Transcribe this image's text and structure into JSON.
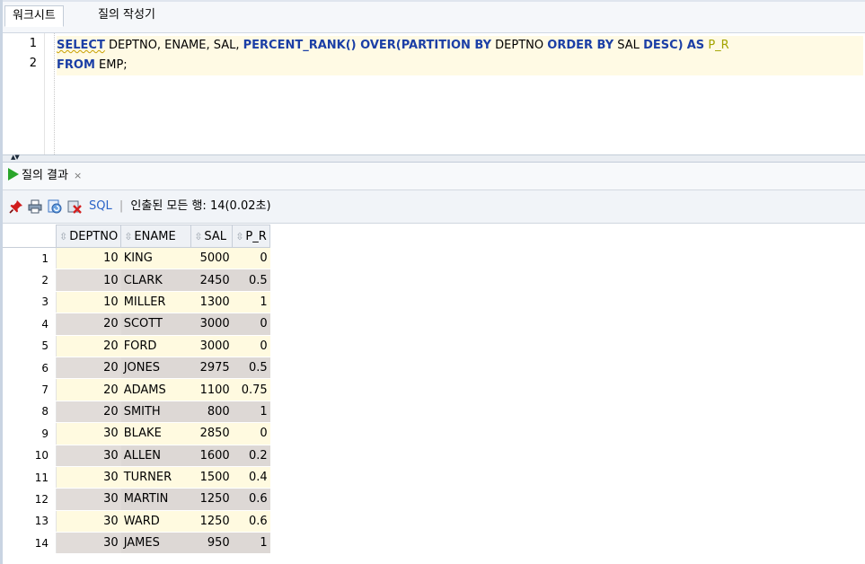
{
  "tabs": [
    "워크시트",
    "질의 작성기"
  ],
  "editor": {
    "line_numbers": [
      "1",
      "2"
    ],
    "line1": {
      "kw_select": "SELECT",
      "t1": " DEPTNO, ENAME, SAL, ",
      "kw_func": "PERCENT_RANK() OVER(PARTITION BY",
      "t2": " DEPTNO ",
      "kw_order": "ORDER BY",
      "t3": " SAL ",
      "kw_desc": "DESC)",
      "t4": " ",
      "kw_as": "AS",
      "t5": " ",
      "alias": "P_R"
    },
    "line2": {
      "kw_from": "FROM",
      "t1": " EMP;"
    }
  },
  "results": {
    "tab_label": "질의 결과",
    "close_glyph": "×",
    "toolbar": {
      "sql_label": "SQL",
      "separator": "|",
      "status": "인출된 모든 행: 14(0.02초)"
    },
    "sort_glyph": "⇳",
    "columns": [
      "DEPTNO",
      "ENAME",
      "SAL",
      "P_R"
    ],
    "rows": [
      {
        "n": "1",
        "deptno": "10",
        "ename": "KING",
        "sal": "5000",
        "p_r": "0"
      },
      {
        "n": "2",
        "deptno": "10",
        "ename": "CLARK",
        "sal": "2450",
        "p_r": "0.5"
      },
      {
        "n": "3",
        "deptno": "10",
        "ename": "MILLER",
        "sal": "1300",
        "p_r": "1"
      },
      {
        "n": "4",
        "deptno": "20",
        "ename": "SCOTT",
        "sal": "3000",
        "p_r": "0"
      },
      {
        "n": "5",
        "deptno": "20",
        "ename": "FORD",
        "sal": "3000",
        "p_r": "0"
      },
      {
        "n": "6",
        "deptno": "20",
        "ename": "JONES",
        "sal": "2975",
        "p_r": "0.5"
      },
      {
        "n": "7",
        "deptno": "20",
        "ename": "ADAMS",
        "sal": "1100",
        "p_r": "0.75"
      },
      {
        "n": "8",
        "deptno": "20",
        "ename": "SMITH",
        "sal": "800",
        "p_r": "1"
      },
      {
        "n": "9",
        "deptno": "30",
        "ename": "BLAKE",
        "sal": "2850",
        "p_r": "0"
      },
      {
        "n": "10",
        "deptno": "30",
        "ename": "ALLEN",
        "sal": "1600",
        "p_r": "0.2"
      },
      {
        "n": "11",
        "deptno": "30",
        "ename": "TURNER",
        "sal": "1500",
        "p_r": "0.4"
      },
      {
        "n": "12",
        "deptno": "30",
        "ename": "MARTIN",
        "sal": "1250",
        "p_r": "0.6"
      },
      {
        "n": "13",
        "deptno": "30",
        "ename": "WARD",
        "sal": "1250",
        "p_r": "0.6"
      },
      {
        "n": "14",
        "deptno": "30",
        "ename": "JAMES",
        "sal": "950",
        "p_r": "1"
      }
    ]
  },
  "icons": [
    "pin-icon",
    "print-icon",
    "refresh-sql-icon",
    "clear-icon"
  ],
  "colors": {
    "keyword": "#1b3fa6",
    "alias": "#a3a300",
    "row_odd": "#fffae0",
    "row_even": "#ddd8d5",
    "run_green": "#2aa52a"
  }
}
